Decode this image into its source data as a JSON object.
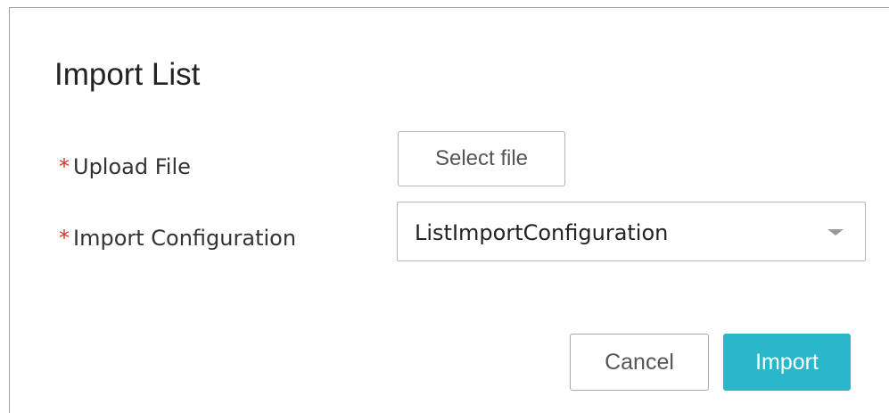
{
  "dialog": {
    "title": "Import List"
  },
  "form": {
    "required_marker": "*",
    "upload_file": {
      "label": "Upload File",
      "button_label": "Select file"
    },
    "import_configuration": {
      "label": "Import Configuration",
      "selected_value": "ListImportConfiguration",
      "caret_icon": "caret-down-icon"
    }
  },
  "footer": {
    "cancel_label": "Cancel",
    "import_label": "Import"
  },
  "colors": {
    "primary": "#2ab7cc",
    "required": "#d9342b"
  }
}
